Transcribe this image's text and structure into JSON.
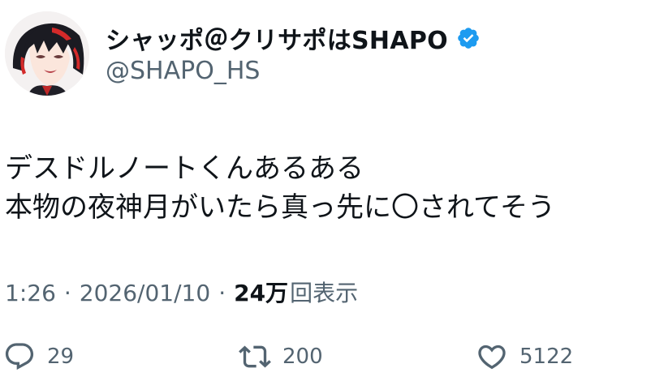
{
  "author": {
    "display_name": "シャッポ＠クリサポはSHAPO",
    "handle": "@SHAPO_HS",
    "avatar_icon": "anime-character-avatar",
    "verified_icon": "verified-badge-icon",
    "verified_color": "#1d9bf0"
  },
  "tweet": {
    "lines": [
      "デスドルノートくんあるある",
      "本物の夜神月がいたら真っ先に〇されてそう"
    ]
  },
  "meta": {
    "time": "1:26",
    "separator": "·",
    "date": "2026/01/10",
    "views_count": "24万",
    "views_label": "回表示"
  },
  "actions": {
    "reply": {
      "icon": "reply-icon",
      "count": "29"
    },
    "retweet": {
      "icon": "retweet-icon",
      "count": "200"
    },
    "like": {
      "icon": "heart-icon",
      "count": "5122"
    }
  },
  "colors": {
    "text": "#0f1419",
    "secondary": "#536471",
    "verified": "#1d9bf0"
  }
}
